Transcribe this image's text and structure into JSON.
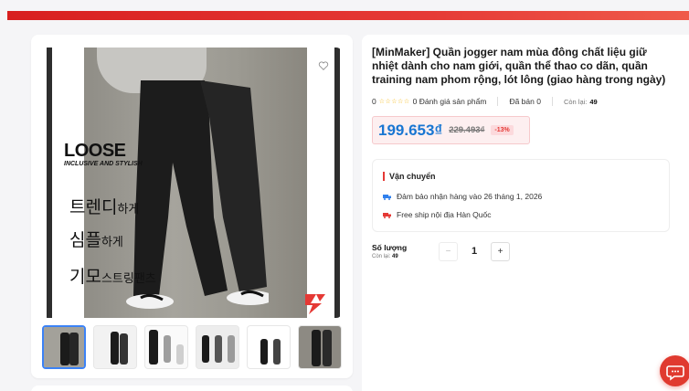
{
  "product": {
    "title": "[MinMaker] Quần jogger nam mùa đông chất liệu giữ nhiệt dành cho nam giới, quần thể thao co dãn, quần training nam phom rộng, lót lông (giao hàng trong ngày)",
    "rating_value": "0",
    "rating_stars": "☆☆☆☆☆",
    "reviews_text": "0 Đánh giá sản phẩm",
    "sold_text": "Đã bán 0",
    "stock_label": "Còn lại:",
    "stock_value": "49",
    "price_current": "199.653₫",
    "price_original": "229.493₫",
    "discount": "-13%"
  },
  "image_overlay": {
    "headline": "LOOSE",
    "tagline": "INCLUSIVE AND STYLISH",
    "line1_big": "트렌디",
    "line1_small": "하게",
    "line2_big": "심플",
    "line2_small": "하게",
    "line3_big": "기모",
    "line3_small": "스트링팬츠"
  },
  "shipping": {
    "title": "Vận chuyển",
    "delivery": "Đảm bảo nhận hàng vào 26 tháng 1, 2026",
    "free_ship": "Free ship nội địa Hàn Quốc"
  },
  "quantity": {
    "label": "Số lượng",
    "stock_label": "Còn lại:",
    "stock_value": "49",
    "minus": "−",
    "value": "1",
    "plus": "+"
  },
  "icons": {
    "favorite": "heart-icon",
    "delivery": "truck-icon",
    "chat": "chat-icon"
  },
  "colors": {
    "accent": "#e53935",
    "price": "#1976d2"
  }
}
